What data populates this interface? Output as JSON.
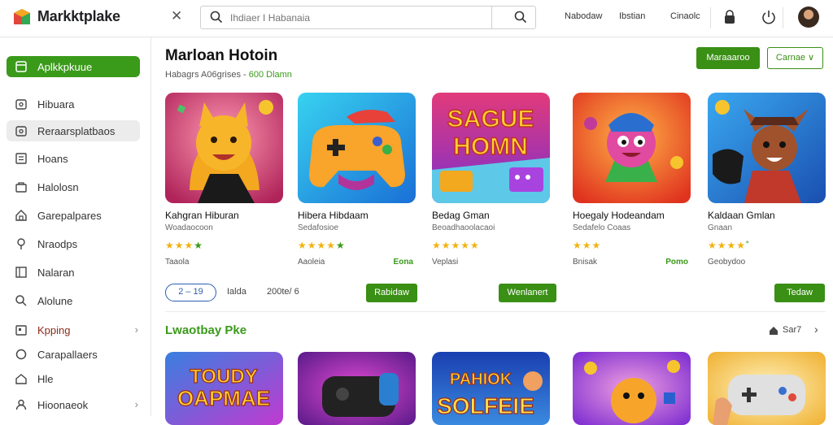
{
  "header": {
    "brand": "Markktplake",
    "search_placeholder": "Ihdiaer I Habanaia",
    "links": [
      "Nabodaw",
      "Ibstian",
      "Cinaolc"
    ]
  },
  "sidebar": {
    "items": [
      {
        "label": "Aplkkpkuue",
        "icon": "app-icon"
      },
      {
        "label": "Hibuara",
        "icon": "tag-icon"
      },
      {
        "label": "Reraarsplatbaos",
        "icon": "tag-icon"
      },
      {
        "label": "Hoans",
        "icon": "list-icon"
      },
      {
        "label": "Halolosn",
        "icon": "bag-icon"
      },
      {
        "label": "Garepalpares",
        "icon": "home-icon"
      },
      {
        "label": "Nraodps",
        "icon": "pin-icon"
      },
      {
        "label": "Nalaran",
        "icon": "grid-icon"
      },
      {
        "label": "Alolune",
        "icon": "search-icon"
      },
      {
        "label": "Kpping",
        "icon": "box-icon"
      },
      {
        "label": "Carapallaers",
        "icon": "circle-icon"
      },
      {
        "label": "Hle",
        "icon": "house-icon"
      },
      {
        "label": "Hioonaeok",
        "icon": "user-icon"
      }
    ]
  },
  "main": {
    "title": "Marloan Hotoin",
    "subtitle_prefix": "Habagrs A06grises -",
    "subtitle_accent": "600 Dlamn",
    "primary_button": "Maraaaroo",
    "outline_button": "Carnae ∨"
  },
  "cards": [
    {
      "name": "Kahgran Hiburan",
      "dev": "Woadaocoon",
      "stars": "★★★",
      "star_green": "★",
      "meta": "Taaola",
      "price": ""
    },
    {
      "name": "Hibera Hibdaam",
      "dev": "Sedafosioe",
      "stars": "★★★★",
      "star_green": "★",
      "meta": "Aaoleia",
      "price": "Eona"
    },
    {
      "name": "Bedag Gman",
      "dev": "Beoadhaoolacaoi",
      "stars": "★★★★★",
      "star_green": "",
      "meta": "Veplasi",
      "price": ""
    },
    {
      "name": "Hoegaly Hodeandam",
      "dev": "Sedafelo Coaas",
      "stars": "★★★",
      "star_green": "",
      "meta": "Bnisak",
      "price": "Pomo"
    },
    {
      "name": "Kaldaan Gmlan",
      "dev": "Gnaan",
      "stars": "★★★★",
      "star_green": "˚",
      "meta": "Geobydoo",
      "price": ""
    }
  ],
  "pager": {
    "label": "2 – 19",
    "text1": "Ialda",
    "text2": "200te/ 6"
  },
  "action_buttons": [
    "Rabidaw",
    "Wenlanert",
    "Tedaw"
  ],
  "section": {
    "title": "Lwaotbay Pke",
    "right_label": "Sar7"
  },
  "colors": {
    "accent": "#3a9a1a",
    "accent_dark": "#3a8f15",
    "pager_blue": "#2a5fb0"
  }
}
